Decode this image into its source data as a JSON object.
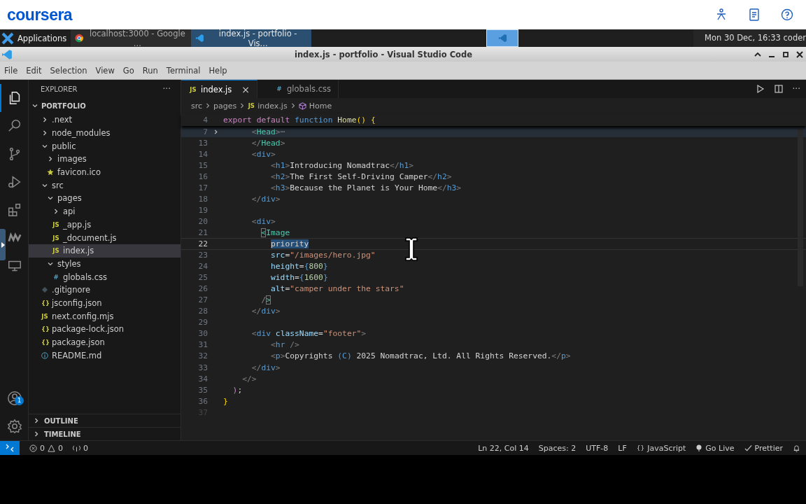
{
  "header": {
    "logo": "coursera"
  },
  "taskbar": {
    "start": "Applications",
    "tasks": [
      {
        "label": "localhost:3000 - Google ...",
        "kind": "chrome",
        "selected": false
      },
      {
        "label": "index.js - portfolio - Vis...",
        "kind": "vscode",
        "selected": true
      }
    ],
    "clock": "Mon 30 Dec, 16:33 coder"
  },
  "window": {
    "title": "index.js - portfolio - Visual Studio Code"
  },
  "menu": [
    "File",
    "Edit",
    "Selection",
    "View",
    "Go",
    "Run",
    "Terminal",
    "Help"
  ],
  "activity": [
    {
      "kind": "files",
      "selected": true
    },
    {
      "kind": "search",
      "selected": false
    },
    {
      "kind": "git",
      "selected": false
    },
    {
      "kind": "run",
      "selected": false
    },
    {
      "kind": "extensions",
      "selected": false
    },
    {
      "kind": "marker",
      "selected": false
    },
    {
      "kind": "remote",
      "selected": false
    }
  ],
  "accounts_badge": "1",
  "explorer": {
    "title": "EXPLORER",
    "more": "···",
    "root": "PORTFOLIO",
    "tree": [
      {
        "label": ".next",
        "kind": "folder",
        "expanded": false
      },
      {
        "label": "node_modules",
        "kind": "folder",
        "expanded": false
      },
      {
        "label": "public",
        "kind": "folder",
        "expanded": true,
        "children": [
          {
            "label": "images",
            "kind": "folder",
            "expanded": false
          },
          {
            "label": "favicon.ico",
            "kind": "star",
            "selected": false
          }
        ]
      },
      {
        "label": "src",
        "kind": "folder",
        "expanded": true,
        "children": [
          {
            "label": "pages",
            "kind": "folder",
            "expanded": true,
            "children": [
              {
                "label": "api",
                "kind": "folder",
                "expanded": false
              },
              {
                "label": "_app.js",
                "kind": "js",
                "icon": "JS",
                "selected": false
              },
              {
                "label": "_document.js",
                "kind": "js",
                "icon": "JS",
                "selected": false
              },
              {
                "label": "index.js",
                "kind": "js",
                "icon": "JS",
                "selected": true
              }
            ]
          },
          {
            "label": "styles",
            "kind": "folder",
            "expanded": true,
            "children": [
              {
                "label": "globals.css",
                "kind": "css",
                "icon": "#",
                "selected": false
              }
            ]
          }
        ]
      },
      {
        "label": ".gitignore",
        "kind": "git",
        "selected": false
      },
      {
        "label": "jsconfig.json",
        "kind": "json",
        "icon": "{}",
        "selected": false
      },
      {
        "label": "next.config.mjs",
        "kind": "js",
        "icon": "JS",
        "selected": false
      },
      {
        "label": "package-lock.json",
        "kind": "json",
        "icon": "{}",
        "selected": false
      },
      {
        "label": "package.json",
        "kind": "json",
        "icon": "{}",
        "selected": false
      },
      {
        "label": "README.md",
        "kind": "info",
        "selected": false
      }
    ],
    "sections": [
      "OUTLINE",
      "TIMELINE"
    ]
  },
  "tabs": [
    {
      "label": "index.js",
      "kind": "js",
      "icon": "JS",
      "selected": true,
      "close": "×"
    },
    {
      "label": "globals.css",
      "kind": "css",
      "icon": "#",
      "selected": false
    }
  ],
  "breadcrumb": [
    {
      "label": "src",
      "kind": "plain"
    },
    {
      "label": "pages",
      "kind": "plain"
    },
    {
      "label": "index.js",
      "kind": "js",
      "icon": "JS"
    },
    {
      "label": "Home",
      "kind": "symbol"
    }
  ],
  "code": [
    {
      "number": "4",
      "sticky": true,
      "tokens": [
        {
          "kind": "kw",
          "text": "export"
        },
        {
          "kind": "kw",
          "text": " default"
        },
        {
          "kind": "blue",
          "text": " function"
        },
        {
          "kind": "fn",
          "text": " Home"
        },
        {
          "kind": "br",
          "text": "()"
        },
        {
          "kind": "br",
          "text": " {"
        }
      ]
    },
    {
      "number": "7",
      "folded": true,
      "tokens": [
        {
          "kind": "p",
          "text": "      <"
        },
        {
          "kind": "tag",
          "text": "Head"
        },
        {
          "kind": "p",
          "text": ">"
        },
        {
          "kind": "fold",
          "text": "⋯"
        }
      ]
    },
    {
      "number": "13",
      "tokens": [
        {
          "kind": "p",
          "text": "      </"
        },
        {
          "kind": "tag",
          "text": "Head"
        },
        {
          "kind": "p",
          "text": ">"
        }
      ]
    },
    {
      "number": "14",
      "tokens": [
        {
          "kind": "p",
          "text": "      <"
        },
        {
          "kind": "blue",
          "text": "div"
        },
        {
          "kind": "p",
          "text": ">"
        }
      ]
    },
    {
      "number": "15",
      "tokens": [
        {
          "kind": "p",
          "text": "          <"
        },
        {
          "kind": "blue",
          "text": "h1"
        },
        {
          "kind": "p",
          "text": ">"
        },
        {
          "kind": "text",
          "text": "Introducing Nomadtrac"
        },
        {
          "kind": "p",
          "text": "</"
        },
        {
          "kind": "blue",
          "text": "h1"
        },
        {
          "kind": "p",
          "text": ">"
        }
      ]
    },
    {
      "number": "16",
      "tokens": [
        {
          "kind": "p",
          "text": "          <"
        },
        {
          "kind": "blue",
          "text": "h2"
        },
        {
          "kind": "p",
          "text": ">"
        },
        {
          "kind": "text",
          "text": "The First Self-Driving Camper"
        },
        {
          "kind": "p",
          "text": "</"
        },
        {
          "kind": "blue",
          "text": "h2"
        },
        {
          "kind": "p",
          "text": ">"
        }
      ]
    },
    {
      "number": "17",
      "tokens": [
        {
          "kind": "p",
          "text": "          <"
        },
        {
          "kind": "blue",
          "text": "h3"
        },
        {
          "kind": "p",
          "text": ">"
        },
        {
          "kind": "text",
          "text": "Because the Planet is Your Home"
        },
        {
          "kind": "p",
          "text": "</"
        },
        {
          "kind": "blue",
          "text": "h3"
        },
        {
          "kind": "p",
          "text": ">"
        }
      ]
    },
    {
      "number": "18",
      "tokens": [
        {
          "kind": "p",
          "text": "      </"
        },
        {
          "kind": "blue",
          "text": "div"
        },
        {
          "kind": "p",
          "text": ">"
        }
      ]
    },
    {
      "number": "19"
    },
    {
      "number": "20",
      "tokens": [
        {
          "kind": "p",
          "text": "      <"
        },
        {
          "kind": "blue",
          "text": "div"
        },
        {
          "kind": "p",
          "text": ">"
        }
      ]
    },
    {
      "number": "21",
      "tokens": [
        {
          "kind": "match",
          "text": "        <"
        },
        {
          "kind": "tag",
          "text": "Image"
        }
      ]
    },
    {
      "number": "22",
      "current": true,
      "tokens": [
        {
          "kind": "sel",
          "text": "          priority"
        }
      ]
    },
    {
      "number": "23",
      "tokens": [
        {
          "kind": "attr",
          "text": "          src"
        },
        {
          "kind": "text",
          "text": "="
        },
        {
          "kind": "str",
          "text": "\"/images/hero.jpg\""
        }
      ]
    },
    {
      "number": "24",
      "tokens": [
        {
          "kind": "attr",
          "text": "          height"
        },
        {
          "kind": "text",
          "text": "="
        },
        {
          "kind": "blue",
          "text": "{"
        },
        {
          "kind": "num",
          "text": "800"
        },
        {
          "kind": "blue",
          "text": "}"
        }
      ]
    },
    {
      "number": "25",
      "tokens": [
        {
          "kind": "attr",
          "text": "          width"
        },
        {
          "kind": "text",
          "text": "="
        },
        {
          "kind": "blue",
          "text": "{"
        },
        {
          "kind": "num",
          "text": "1600"
        },
        {
          "kind": "blue",
          "text": "}"
        }
      ]
    },
    {
      "number": "26",
      "tokens": [
        {
          "kind": "attr",
          "text": "          alt"
        },
        {
          "kind": "text",
          "text": "="
        },
        {
          "kind": "str",
          "text": "\"camper under the stars\""
        }
      ]
    },
    {
      "number": "27",
      "tokens": [
        {
          "kind": "p",
          "text": "        /"
        },
        {
          "kind": "match",
          "text": ">"
        }
      ]
    },
    {
      "number": "28",
      "tokens": [
        {
          "kind": "p",
          "text": "      </"
        },
        {
          "kind": "blue",
          "text": "div"
        },
        {
          "kind": "p",
          "text": ">"
        }
      ]
    },
    {
      "number": "29"
    },
    {
      "number": "30",
      "tokens": [
        {
          "kind": "p",
          "text": "      <"
        },
        {
          "kind": "blue",
          "text": "div"
        },
        {
          "kind": "attr",
          "text": " className"
        },
        {
          "kind": "text",
          "text": "="
        },
        {
          "kind": "str",
          "text": "\"footer\""
        },
        {
          "kind": "p",
          "text": ">"
        }
      ]
    },
    {
      "number": "31",
      "tokens": [
        {
          "kind": "p",
          "text": "          <"
        },
        {
          "kind": "blue",
          "text": "hr"
        },
        {
          "kind": "p",
          "text": " />"
        }
      ]
    },
    {
      "number": "32",
      "tokens": [
        {
          "kind": "p",
          "text": "          <"
        },
        {
          "kind": "blue",
          "text": "p"
        },
        {
          "kind": "p",
          "text": ">"
        },
        {
          "kind": "text",
          "text": "Copyrights "
        },
        {
          "kind": "blue",
          "text": "(C)"
        },
        {
          "kind": "text",
          "text": " 2025 Nomadtrac, Ltd. All Rights Reserved."
        },
        {
          "kind": "p",
          "text": "</"
        },
        {
          "kind": "blue",
          "text": "p"
        },
        {
          "kind": "p",
          "text": ">"
        }
      ]
    },
    {
      "number": "33",
      "tokens": [
        {
          "kind": "p",
          "text": "      </"
        },
        {
          "kind": "blue",
          "text": "div"
        },
        {
          "kind": "p",
          "text": ">"
        }
      ]
    },
    {
      "number": "34",
      "tokens": [
        {
          "kind": "p",
          "text": "    </>"
        }
      ]
    },
    {
      "number": "35",
      "tokens": [
        {
          "kind": "kw",
          "text": "  )"
        },
        {
          "kind": "text",
          "text": ";"
        }
      ]
    },
    {
      "number": "36",
      "tokens": [
        {
          "kind": "br",
          "text": "}"
        }
      ]
    },
    {
      "number": "37",
      "dim": true
    }
  ],
  "status": {
    "errors": "0",
    "warnings": "0",
    "ports": "0",
    "right": [
      {
        "label": "Ln 22, Col 14",
        "kind": "plain"
      },
      {
        "label": "Spaces: 2",
        "kind": "plain"
      },
      {
        "label": "UTF-8",
        "kind": "plain"
      },
      {
        "label": "LF",
        "kind": "plain"
      },
      {
        "label": "JavaScript",
        "kind": "braces",
        "icon": "{}"
      },
      {
        "label": "Go Live",
        "kind": "live"
      },
      {
        "label": "Prettier",
        "kind": "check"
      }
    ]
  }
}
